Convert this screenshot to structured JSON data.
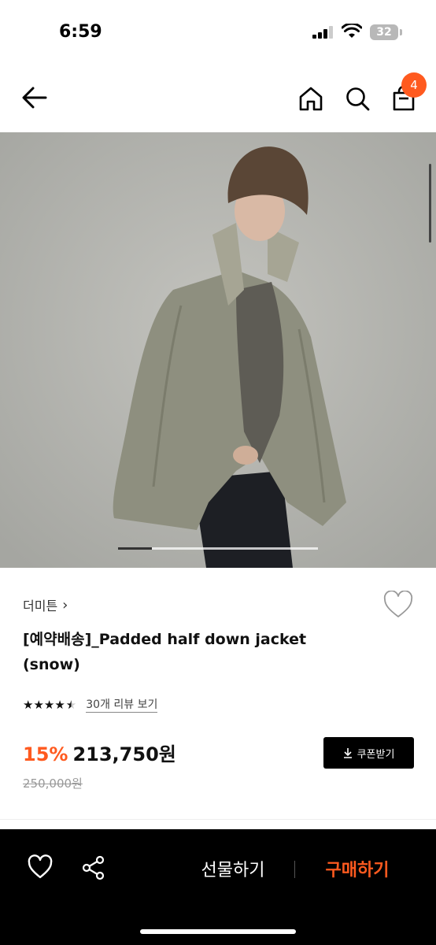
{
  "status_bar": {
    "time": "6:59",
    "battery": "32"
  },
  "header": {
    "cart_count": "4"
  },
  "colors": {
    "accent": "#ff5a1f",
    "bottom_bar": "#000000"
  },
  "icons": {
    "back": "arrow-left-icon",
    "home": "home-icon",
    "search": "search-icon",
    "cart": "shopping-bag-icon",
    "wishlist": "heart-icon",
    "share": "share-icon",
    "download": "download-icon"
  },
  "product": {
    "brand": "더미튼",
    "brand_chevron": "›",
    "title": "[예약배송]_Padded half down jacket (snow)",
    "rating_value": 4.5,
    "stars": "★★★★",
    "star_half": "★",
    "review_link": "30개 리뷰 보기",
    "discount": "15%",
    "price": "213,750원",
    "original_price": "250,000원",
    "coupon_label": "쿠폰받기"
  },
  "image_carousel": {
    "current": 1,
    "total": 6
  },
  "bottom_bar": {
    "gift_label": "선물하기",
    "buy_label": "구매하기"
  }
}
